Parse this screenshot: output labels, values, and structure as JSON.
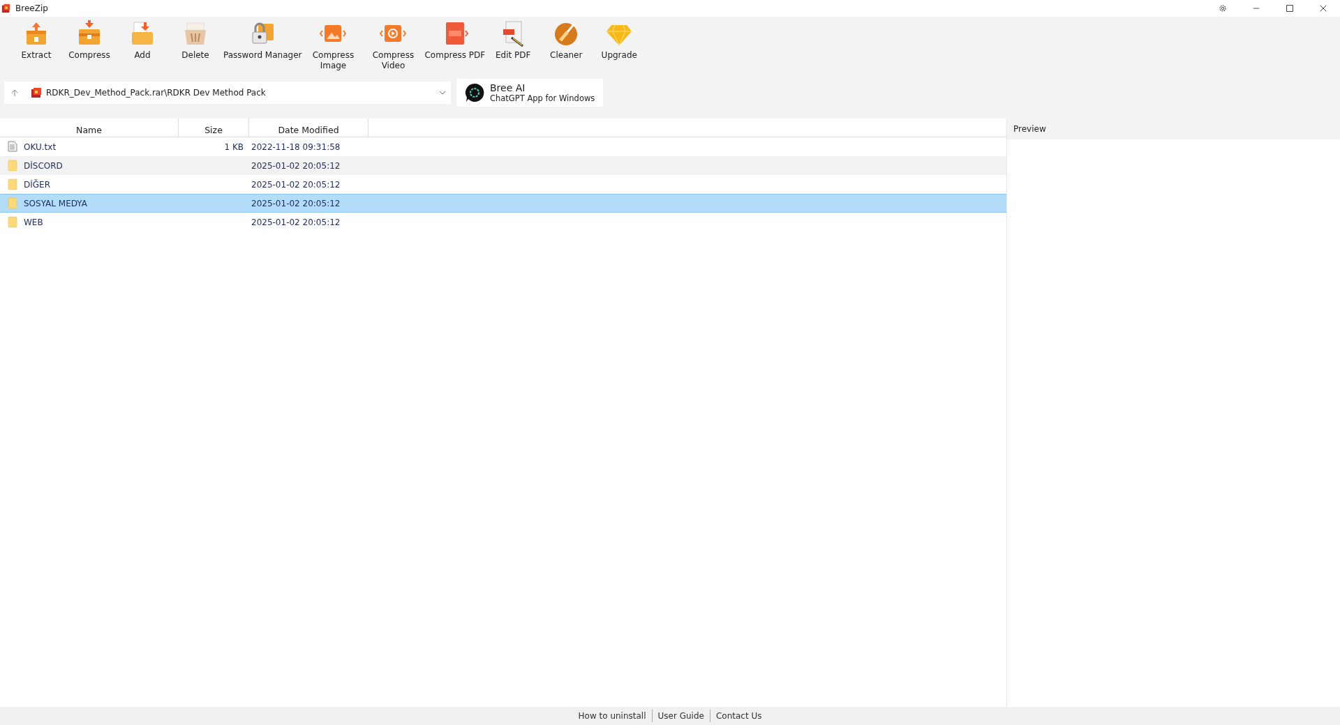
{
  "window": {
    "title": "BreeZip"
  },
  "toolbar": [
    {
      "label": "Extract",
      "kind": "extract"
    },
    {
      "label": "Compress",
      "kind": "compress"
    },
    {
      "label": "Add",
      "kind": "add"
    },
    {
      "label": "Delete",
      "kind": "delete"
    },
    {
      "label": "Password Manager",
      "kind": "password"
    },
    {
      "label": "Compress Image",
      "kind": "image"
    },
    {
      "label": "Compress Video",
      "kind": "video"
    },
    {
      "label": "Compress PDF",
      "kind": "pdf"
    },
    {
      "label": "Edit PDF",
      "kind": "editpdf"
    },
    {
      "label": "Cleaner",
      "kind": "cleaner"
    },
    {
      "label": "Upgrade",
      "kind": "upgrade"
    }
  ],
  "address_bar": {
    "path": "RDKR_Dev_Method_Pack.rar\\RDKR Dev Method Pack"
  },
  "promo": {
    "title": "Bree AI",
    "subtitle": "ChatGPT App for Windows"
  },
  "table": {
    "columns": [
      "Name",
      "Size",
      "Date Modified"
    ],
    "rows": [
      {
        "kind": "file",
        "name": "OKU.txt",
        "size": "1 KB",
        "date": "2022-11-18 09:31:58",
        "selected": false,
        "hovered": false
      },
      {
        "kind": "folder",
        "name": "DİSCORD",
        "date": "2025-01-02 20:05:12",
        "selected": false,
        "hovered": true
      },
      {
        "kind": "folder",
        "name": "DİĞER",
        "date": "2025-01-02 20:05:12",
        "selected": false,
        "hovered": false
      },
      {
        "kind": "folder",
        "name": "SOSYAL MEDYA",
        "date": "2025-01-02 20:05:12",
        "selected": true,
        "hovered": false
      },
      {
        "kind": "folder",
        "name": "WEB",
        "date": "2025-01-02 20:05:12",
        "selected": false,
        "hovered": false
      }
    ]
  },
  "preview": {
    "title": "Preview"
  },
  "footer_links": [
    "How to uninstall",
    "User Guide",
    "Contact Us"
  ]
}
